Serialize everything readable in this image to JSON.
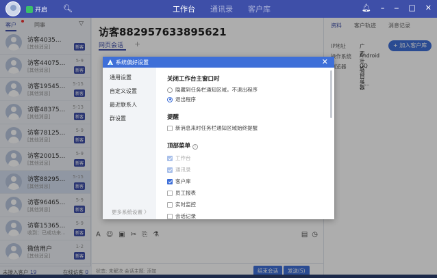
{
  "topbar": {
    "status": "开启",
    "nav": [
      "工作台",
      "通讯录",
      "客户库"
    ],
    "nav_active": 0
  },
  "left": {
    "tabs": [
      "客户",
      "同事"
    ],
    "conversations": [
      {
        "name": "访客4035...",
        "sub": "[其他消息]",
        "time": "",
        "badge": "新客"
      },
      {
        "name": "访客44075...",
        "sub": "[其他消息]",
        "time": "5-9",
        "badge": "新客"
      },
      {
        "name": "访客19545...",
        "sub": "[其他消息]",
        "time": "5-15",
        "badge": "新客"
      },
      {
        "name": "访客48375...",
        "sub": "[其他消息]",
        "time": "5-13",
        "badge": "新客"
      },
      {
        "name": "访客78125...",
        "sub": "[其他消息]",
        "time": "5-9",
        "badge": "新客"
      },
      {
        "name": "访客20015...",
        "sub": "[其他消息]",
        "time": "5-9",
        "badge": "新客"
      },
      {
        "name": "访客88295...",
        "sub": "[其他消息]",
        "time": "5-15",
        "badge": "新客"
      },
      {
        "name": "访客96465...",
        "sub": "[其他消息]",
        "time": "5-9",
        "badge": "新客"
      },
      {
        "name": "访客15365...",
        "sub": "收到：已成功来...",
        "time": "5-9",
        "badge": "新客"
      },
      {
        "name": "微信用户",
        "sub": "[其他消息]",
        "time": "1-2",
        "badge": "新客"
      }
    ],
    "footer": {
      "pending_label": "未接入客户",
      "pending_count": "19",
      "online_label": "在线访客",
      "online_count": "0"
    }
  },
  "middle": {
    "title": "访客882957633895621",
    "subtab": "网页会话",
    "bottom_info": "状态: 未解决   会话主题: 添加",
    "end_button": "结束会话",
    "send_button": "发送(S)"
  },
  "right": {
    "tabs": [
      "资料",
      "客户轨迹",
      "消息记录"
    ],
    "add_customer": "+ 加入客户库",
    "rows": [
      {
        "label": "IP地址",
        "value": "广西壮族自治..."
      },
      {
        "label": "操作系统",
        "value": "Android"
      },
      {
        "label": "浏览器",
        "value": "QQ浏览器"
      }
    ]
  },
  "modal": {
    "title": "系统偏好设置",
    "sidebar": [
      "通用设置",
      "自定义设置",
      "最近联系人",
      "群设置"
    ],
    "more_settings": "更多系统设置 〉",
    "close_main": {
      "heading": "关闭工作台主窗口时",
      "options": [
        {
          "label": "隐藏到任务栏通知区域，不退出程序",
          "selected": false
        },
        {
          "label": "退出程序",
          "selected": true
        }
      ]
    },
    "reminder": {
      "heading": "提醒",
      "option": "新消息来时任务栏通知区域始终提醒"
    },
    "top_menu": {
      "heading": "顶部菜单",
      "items": [
        {
          "label": "工作台",
          "checked": true,
          "disabled": true
        },
        {
          "label": "通讯录",
          "checked": true,
          "disabled": true
        },
        {
          "label": "客户库",
          "checked": true,
          "disabled": false
        },
        {
          "label": "员工报表",
          "checked": false,
          "disabled": false
        },
        {
          "label": "实时监控",
          "checked": false,
          "disabled": false
        },
        {
          "label": "会话记录",
          "checked": false,
          "disabled": false
        }
      ]
    }
  }
}
